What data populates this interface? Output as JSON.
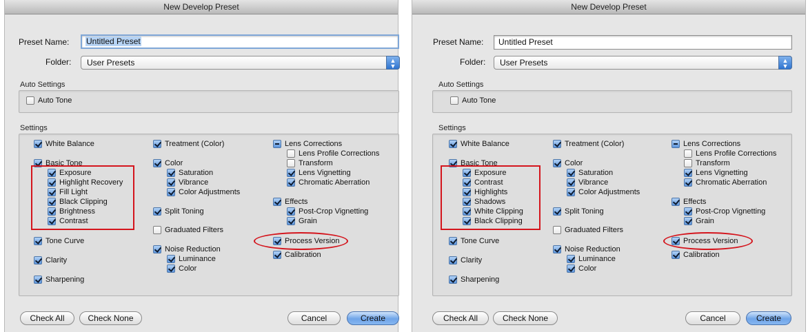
{
  "dialogs": [
    {
      "title": "New Develop Preset",
      "preset_name_label": "Preset Name:",
      "preset_name_value": "Untitled Preset",
      "folder_label": "Folder:",
      "folder_value": "User Presets",
      "auto_settings_label": "Auto Settings",
      "auto_tone": "Auto Tone",
      "settings_label": "Settings",
      "white_balance": "White Balance",
      "basic_tone": "Basic Tone",
      "basic_tone_items": [
        "Exposure",
        "Highlight Recovery",
        "Fill Light",
        "Black Clipping",
        "Brightness",
        "Contrast"
      ],
      "tone_curve": "Tone Curve",
      "clarity": "Clarity",
      "sharpening": "Sharpening",
      "treatment": "Treatment (Color)",
      "color": "Color",
      "color_items": [
        "Saturation",
        "Vibrance",
        "Color Adjustments"
      ],
      "split_toning": "Split Toning",
      "graduated_filters": "Graduated Filters",
      "noise_reduction": "Noise Reduction",
      "noise_items": [
        "Luminance",
        "Color"
      ],
      "lens_corrections": "Lens Corrections",
      "lens_items": [
        "Lens Profile Corrections",
        "Transform",
        "Lens Vignetting",
        "Chromatic Aberration"
      ],
      "effects": "Effects",
      "effects_items": [
        "Post-Crop Vignetting",
        "Grain"
      ],
      "process_version": "Process Version",
      "calibration": "Calibration",
      "check_all": "Check All",
      "check_none": "Check None",
      "cancel": "Cancel",
      "create": "Create"
    },
    {
      "title": "New Develop Preset",
      "preset_name_label": "Preset Name:",
      "preset_name_value": "Untitled Preset",
      "folder_label": "Folder:",
      "folder_value": "User Presets",
      "auto_settings_label": "Auto Settings",
      "auto_tone": "Auto Tone",
      "settings_label": "Settings",
      "white_balance": "White Balance",
      "basic_tone": "Basic Tone",
      "basic_tone_items": [
        "Exposure",
        "Contrast",
        "Highlights",
        "Shadows",
        "White Clipping",
        "Black Clipping"
      ],
      "tone_curve": "Tone Curve",
      "clarity": "Clarity",
      "sharpening": "Sharpening",
      "treatment": "Treatment (Color)",
      "color": "Color",
      "color_items": [
        "Saturation",
        "Vibrance",
        "Color Adjustments"
      ],
      "split_toning": "Split Toning",
      "graduated_filters": "Graduated Filters",
      "noise_reduction": "Noise Reduction",
      "noise_items": [
        "Luminance",
        "Color"
      ],
      "lens_corrections": "Lens Corrections",
      "lens_items": [
        "Lens Profile Corrections",
        "Transform",
        "Lens Vignetting",
        "Chromatic Aberration"
      ],
      "effects": "Effects",
      "effects_items": [
        "Post-Crop Vignetting",
        "Grain"
      ],
      "process_version": "Process Version",
      "calibration": "Calibration",
      "check_all": "Check All",
      "check_none": "Check None",
      "cancel": "Cancel",
      "create": "Create"
    }
  ],
  "colors": {
    "highlight_annotation": "#d4141c",
    "default_button": "#6fa4e8",
    "checkbox_checked": "#5d95dc"
  },
  "icons": {
    "select_arrows": "up-down-chevron-icon",
    "checkbox": "checkmark-icon"
  }
}
